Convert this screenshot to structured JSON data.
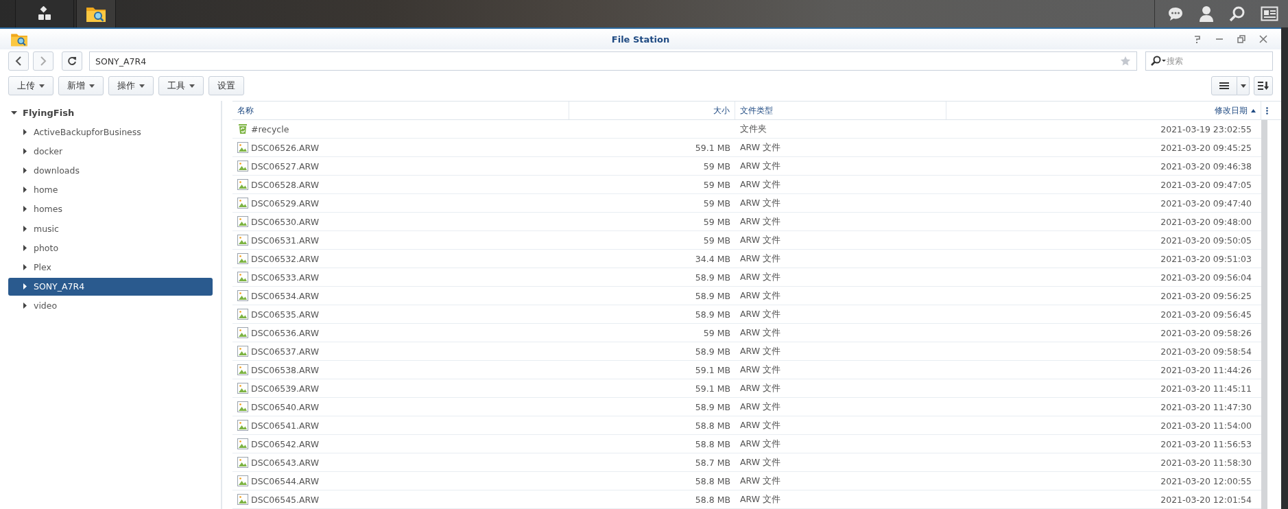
{
  "window": {
    "title": "File Station"
  },
  "address_bar": {
    "path": "SONY_A7R4"
  },
  "search": {
    "placeholder": "搜索"
  },
  "toolbar": {
    "buttons": [
      {
        "label": "上传",
        "dropdown": true
      },
      {
        "label": "新增",
        "dropdown": true
      },
      {
        "label": "操作",
        "dropdown": true
      },
      {
        "label": "工具",
        "dropdown": true
      },
      {
        "label": "设置",
        "dropdown": false
      }
    ]
  },
  "sidebar": {
    "tree": [
      {
        "label": "FlyingFish",
        "expanded": true,
        "selected": false,
        "children": [
          {
            "label": "ActiveBackupforBusiness",
            "expanded": false,
            "selected": false
          },
          {
            "label": "docker",
            "expanded": false,
            "selected": false
          },
          {
            "label": "downloads",
            "expanded": false,
            "selected": false
          },
          {
            "label": "home",
            "expanded": false,
            "selected": false
          },
          {
            "label": "homes",
            "expanded": false,
            "selected": false
          },
          {
            "label": "music",
            "expanded": false,
            "selected": false
          },
          {
            "label": "photo",
            "expanded": false,
            "selected": false
          },
          {
            "label": "Plex",
            "expanded": false,
            "selected": false
          },
          {
            "label": "SONY_A7R4",
            "expanded": false,
            "selected": true
          },
          {
            "label": "video",
            "expanded": false,
            "selected": false
          }
        ]
      }
    ]
  },
  "table": {
    "columns": [
      {
        "label": "名称",
        "sorted": false
      },
      {
        "label": "大小",
        "sorted": false
      },
      {
        "label": "文件类型",
        "sorted": false
      },
      {
        "label": "修改日期",
        "sorted": true
      }
    ],
    "rows": [
      {
        "kind": "folder",
        "name": "#recycle",
        "type": "文件夹",
        "modified": "2021-03-19 23:02:55"
      },
      {
        "kind": "image",
        "name": "DSC06526.ARW",
        "size": "59.1 MB",
        "type": "ARW 文件",
        "modified": "2021-03-20 09:45:25"
      },
      {
        "kind": "image",
        "name": "DSC06527.ARW",
        "size": "59 MB",
        "type": "ARW 文件",
        "modified": "2021-03-20 09:46:38"
      },
      {
        "kind": "image",
        "name": "DSC06528.ARW",
        "size": "59 MB",
        "type": "ARW 文件",
        "modified": "2021-03-20 09:47:05"
      },
      {
        "kind": "image",
        "name": "DSC06529.ARW",
        "size": "59 MB",
        "type": "ARW 文件",
        "modified": "2021-03-20 09:47:40"
      },
      {
        "kind": "image",
        "name": "DSC06530.ARW",
        "size": "59 MB",
        "type": "ARW 文件",
        "modified": "2021-03-20 09:48:00"
      },
      {
        "kind": "image",
        "name": "DSC06531.ARW",
        "size": "59 MB",
        "type": "ARW 文件",
        "modified": "2021-03-20 09:50:05"
      },
      {
        "kind": "image",
        "name": "DSC06532.ARW",
        "size": "34.4 MB",
        "type": "ARW 文件",
        "modified": "2021-03-20 09:51:03"
      },
      {
        "kind": "image",
        "name": "DSC06533.ARW",
        "size": "58.9 MB",
        "type": "ARW 文件",
        "modified": "2021-03-20 09:56:04"
      },
      {
        "kind": "image",
        "name": "DSC06534.ARW",
        "size": "58.9 MB",
        "type": "ARW 文件",
        "modified": "2021-03-20 09:56:25"
      },
      {
        "kind": "image",
        "name": "DSC06535.ARW",
        "size": "58.9 MB",
        "type": "ARW 文件",
        "modified": "2021-03-20 09:56:45"
      },
      {
        "kind": "image",
        "name": "DSC06536.ARW",
        "size": "59 MB",
        "type": "ARW 文件",
        "modified": "2021-03-20 09:58:26"
      },
      {
        "kind": "image",
        "name": "DSC06537.ARW",
        "size": "58.9 MB",
        "type": "ARW 文件",
        "modified": "2021-03-20 09:58:54"
      },
      {
        "kind": "image",
        "name": "DSC06538.ARW",
        "size": "59.1 MB",
        "type": "ARW 文件",
        "modified": "2021-03-20 11:44:26"
      },
      {
        "kind": "image",
        "name": "DSC06539.ARW",
        "size": "59.1 MB",
        "type": "ARW 文件",
        "modified": "2021-03-20 11:45:11"
      },
      {
        "kind": "image",
        "name": "DSC06540.ARW",
        "size": "58.9 MB",
        "type": "ARW 文件",
        "modified": "2021-03-20 11:47:30"
      },
      {
        "kind": "image",
        "name": "DSC06541.ARW",
        "size": "58.8 MB",
        "type": "ARW 文件",
        "modified": "2021-03-20 11:54:00"
      },
      {
        "kind": "image",
        "name": "DSC06542.ARW",
        "size": "58.8 MB",
        "type": "ARW 文件",
        "modified": "2021-03-20 11:56:53"
      },
      {
        "kind": "image",
        "name": "DSC06543.ARW",
        "size": "58.7 MB",
        "type": "ARW 文件",
        "modified": "2021-03-20 11:58:30"
      },
      {
        "kind": "image",
        "name": "DSC06544.ARW",
        "size": "58.8 MB",
        "type": "ARW 文件",
        "modified": "2021-03-20 12:00:55"
      },
      {
        "kind": "image",
        "name": "DSC06545.ARW",
        "size": "58.8 MB",
        "type": "ARW 文件",
        "modified": "2021-03-20 12:01:54"
      }
    ]
  }
}
